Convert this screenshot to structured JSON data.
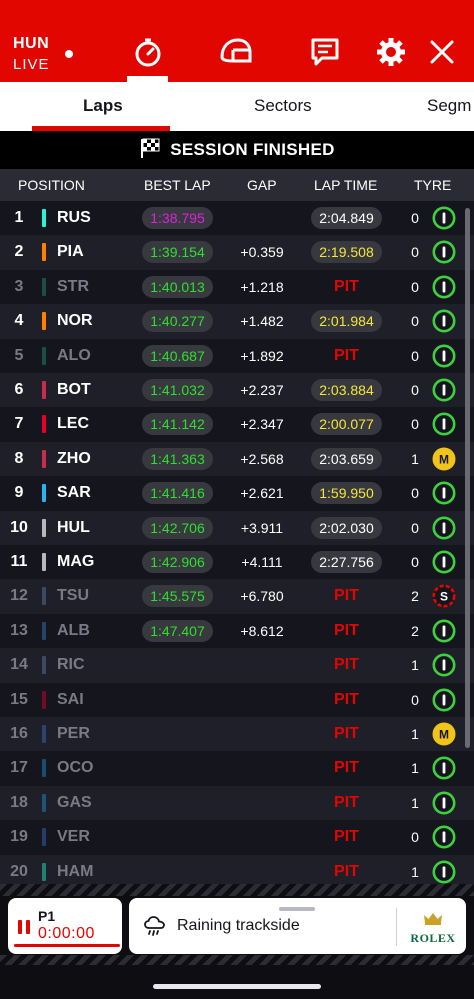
{
  "header": {
    "location": "HUN",
    "status": "LIVE"
  },
  "tabs": [
    {
      "label": "Laps"
    },
    {
      "label": "Sectors"
    },
    {
      "label": "Segm"
    }
  ],
  "session_banner": "SESSION FINISHED",
  "columns": [
    "POSITION",
    "BEST LAP",
    "GAP",
    "LAP TIME",
    "TYRE"
  ],
  "rows": [
    {
      "pos": "1",
      "driver": "RUS",
      "color": "#27f4d2",
      "best": "1:38.795",
      "best_color": "#e020e0",
      "gap": "",
      "lap": "2:04.849",
      "lap_color": "#ffffff",
      "tyre_laps": "0",
      "tyre": "I",
      "tyre_color": "#3dd23d",
      "pit": false,
      "out": false
    },
    {
      "pos": "2",
      "driver": "PIA",
      "color": "#ff8000",
      "best": "1:39.154",
      "best_color": "#2fdf2f",
      "gap": "+0.359",
      "lap": "2:19.508",
      "lap_color": "#f5e53c",
      "tyre_laps": "0",
      "tyre": "I",
      "tyre_color": "#3dd23d",
      "pit": false,
      "out": false
    },
    {
      "pos": "3",
      "driver": "STR",
      "color": "#229971",
      "best": "1:40.013",
      "best_color": "#2fdf2f",
      "gap": "+1.218",
      "lap": "PIT",
      "lap_color": "#e10600",
      "tyre_laps": "0",
      "tyre": "I",
      "tyre_color": "#3dd23d",
      "pit": true,
      "out": true
    },
    {
      "pos": "4",
      "driver": "NOR",
      "color": "#ff8000",
      "best": "1:40.277",
      "best_color": "#2fdf2f",
      "gap": "+1.482",
      "lap": "2:01.984",
      "lap_color": "#f5e53c",
      "tyre_laps": "0",
      "tyre": "I",
      "tyre_color": "#3dd23d",
      "pit": false,
      "out": false
    },
    {
      "pos": "5",
      "driver": "ALO",
      "color": "#229971",
      "best": "1:40.687",
      "best_color": "#2fdf2f",
      "gap": "+1.892",
      "lap": "PIT",
      "lap_color": "#e10600",
      "tyre_laps": "0",
      "tyre": "I",
      "tyre_color": "#3dd23d",
      "pit": true,
      "out": true
    },
    {
      "pos": "6",
      "driver": "BOT",
      "color": "#c92d4b",
      "best": "1:41.032",
      "best_color": "#2fdf2f",
      "gap": "+2.237",
      "lap": "2:03.884",
      "lap_color": "#f5e53c",
      "tyre_laps": "0",
      "tyre": "I",
      "tyre_color": "#3dd23d",
      "pit": false,
      "out": false
    },
    {
      "pos": "7",
      "driver": "LEC",
      "color": "#e8002d",
      "best": "1:41.142",
      "best_color": "#2fdf2f",
      "gap": "+2.347",
      "lap": "2:00.077",
      "lap_color": "#f5e53c",
      "tyre_laps": "0",
      "tyre": "I",
      "tyre_color": "#3dd23d",
      "pit": false,
      "out": false
    },
    {
      "pos": "8",
      "driver": "ZHO",
      "color": "#c92d4b",
      "best": "1:41.363",
      "best_color": "#2fdf2f",
      "gap": "+2.568",
      "lap": "2:03.659",
      "lap_color": "#ffffff",
      "tyre_laps": "1",
      "tyre": "M",
      "tyre_color": "#f0c419",
      "pit": false,
      "out": false
    },
    {
      "pos": "9",
      "driver": "SAR",
      "color": "#27b4f0",
      "best": "1:41.416",
      "best_color": "#2fdf2f",
      "gap": "+2.621",
      "lap": "1:59.950",
      "lap_color": "#f5e53c",
      "tyre_laps": "0",
      "tyre": "I",
      "tyre_color": "#3dd23d",
      "pit": false,
      "out": false
    },
    {
      "pos": "10",
      "driver": "HUL",
      "color": "#b6babd",
      "best": "1:42.706",
      "best_color": "#2fdf2f",
      "gap": "+3.911",
      "lap": "2:02.030",
      "lap_color": "#ffffff",
      "tyre_laps": "0",
      "tyre": "I",
      "tyre_color": "#3dd23d",
      "pit": false,
      "out": false
    },
    {
      "pos": "11",
      "driver": "MAG",
      "color": "#b6babd",
      "best": "1:42.906",
      "best_color": "#2fdf2f",
      "gap": "+4.111",
      "lap": "2:27.756",
      "lap_color": "#ffffff",
      "tyre_laps": "0",
      "tyre": "I",
      "tyre_color": "#3dd23d",
      "pit": false,
      "out": false
    },
    {
      "pos": "12",
      "driver": "TSU",
      "color": "#5e7fa8",
      "best": "1:45.575",
      "best_color": "#2fdf2f",
      "gap": "+6.780",
      "lap": "PIT",
      "lap_color": "#e10600",
      "tyre_laps": "2",
      "tyre": "S",
      "tyre_color": "#e10600",
      "pit": true,
      "out": true
    },
    {
      "pos": "13",
      "driver": "ALB",
      "color": "#3a7ec4",
      "best": "1:47.407",
      "best_color": "#2fdf2f",
      "gap": "+8.612",
      "lap": "PIT",
      "lap_color": "#e10600",
      "tyre_laps": "2",
      "tyre": "I",
      "tyre_color": "#3dd23d",
      "pit": true,
      "out": true
    },
    {
      "pos": "14",
      "driver": "RIC",
      "color": "#5e7fa8",
      "best": "",
      "best_color": "#2fdf2f",
      "gap": "",
      "lap": "PIT",
      "lap_color": "#e10600",
      "tyre_laps": "1",
      "tyre": "I",
      "tyre_color": "#3dd23d",
      "pit": true,
      "out": true
    },
    {
      "pos": "15",
      "driver": "SAI",
      "color": "#e8002d",
      "best": "",
      "best_color": "#2fdf2f",
      "gap": "",
      "lap": "PIT",
      "lap_color": "#e10600",
      "tyre_laps": "0",
      "tyre": "I",
      "tyre_color": "#3dd23d",
      "pit": true,
      "out": true
    },
    {
      "pos": "16",
      "driver": "PER",
      "color": "#3671c6",
      "best": "",
      "best_color": "#2fdf2f",
      "gap": "",
      "lap": "PIT",
      "lap_color": "#e10600",
      "tyre_laps": "1",
      "tyre": "M",
      "tyre_color": "#f0c419",
      "pit": true,
      "out": true
    },
    {
      "pos": "17",
      "driver": "OCO",
      "color": "#2293d1",
      "best": "",
      "best_color": "#2fdf2f",
      "gap": "",
      "lap": "PIT",
      "lap_color": "#e10600",
      "tyre_laps": "1",
      "tyre": "I",
      "tyre_color": "#3dd23d",
      "pit": true,
      "out": true
    },
    {
      "pos": "18",
      "driver": "GAS",
      "color": "#2293d1",
      "best": "",
      "best_color": "#2fdf2f",
      "gap": "",
      "lap": "PIT",
      "lap_color": "#e10600",
      "tyre_laps": "1",
      "tyre": "I",
      "tyre_color": "#3dd23d",
      "pit": true,
      "out": true
    },
    {
      "pos": "19",
      "driver": "VER",
      "color": "#3671c6",
      "best": "",
      "best_color": "#2fdf2f",
      "gap": "",
      "lap": "PIT",
      "lap_color": "#e10600",
      "tyre_laps": "0",
      "tyre": "I",
      "tyre_color": "#3dd23d",
      "pit": true,
      "out": true
    },
    {
      "pos": "20",
      "driver": "HAM",
      "color": "#27f4d2",
      "best": "",
      "best_color": "#2fdf2f",
      "gap": "",
      "lap": "PIT",
      "lap_color": "#e10600",
      "tyre_laps": "1",
      "tyre": "I",
      "tyre_color": "#3dd23d",
      "pit": true,
      "out": true
    }
  ],
  "timer": {
    "session": "P1",
    "time": "0:00:00"
  },
  "weather": {
    "text": "Raining trackside"
  },
  "sponsor": {
    "name": "ROLEX"
  },
  "icons": [
    "stopwatch-icon",
    "helmet-icon",
    "chat-icon",
    "gear-icon",
    "close-icon",
    "checkered-flag-icon",
    "pause-icon",
    "rain-cloud-icon",
    "crown-icon"
  ]
}
